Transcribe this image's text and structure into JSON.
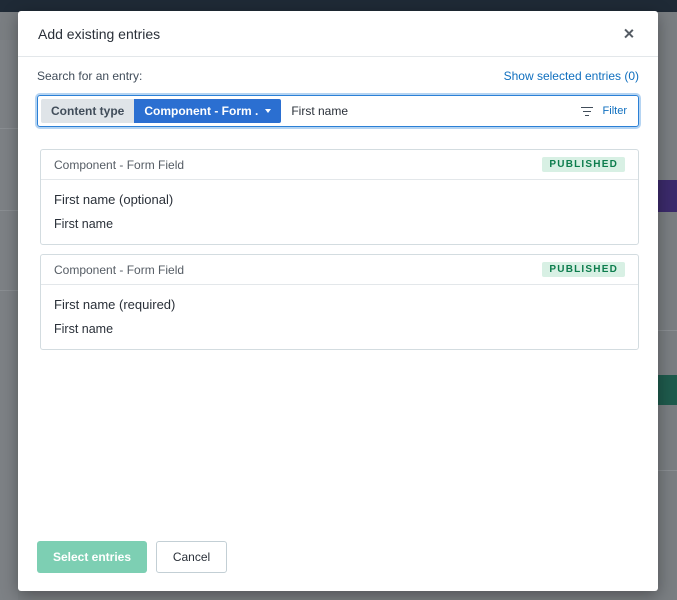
{
  "modal": {
    "title": "Add existing entries",
    "search_label": "Search for an entry:",
    "show_selected": "Show selected entries (0)",
    "search": {
      "content_type_label": "Content type",
      "content_type_value": "Component - Form ...",
      "query": "First name",
      "filter_label": "Filter"
    },
    "entries": [
      {
        "content_type": "Component - Form Field",
        "status": "PUBLISHED",
        "title": "First name (optional)",
        "description": "First name"
      },
      {
        "content_type": "Component - Form Field",
        "status": "PUBLISHED",
        "title": "First name (required)",
        "description": "First name"
      }
    ],
    "footer": {
      "primary": "Select entries",
      "secondary": "Cancel"
    }
  },
  "colors": {
    "accent": "#2b6fd1",
    "link": "#0f6fbf",
    "published_bg": "#d8f0e4",
    "published_fg": "#0d7d4d",
    "primary_disabled": "#7dcfb3"
  },
  "icons": [
    "close-icon",
    "filter-icon",
    "chevron-down-icon"
  ]
}
